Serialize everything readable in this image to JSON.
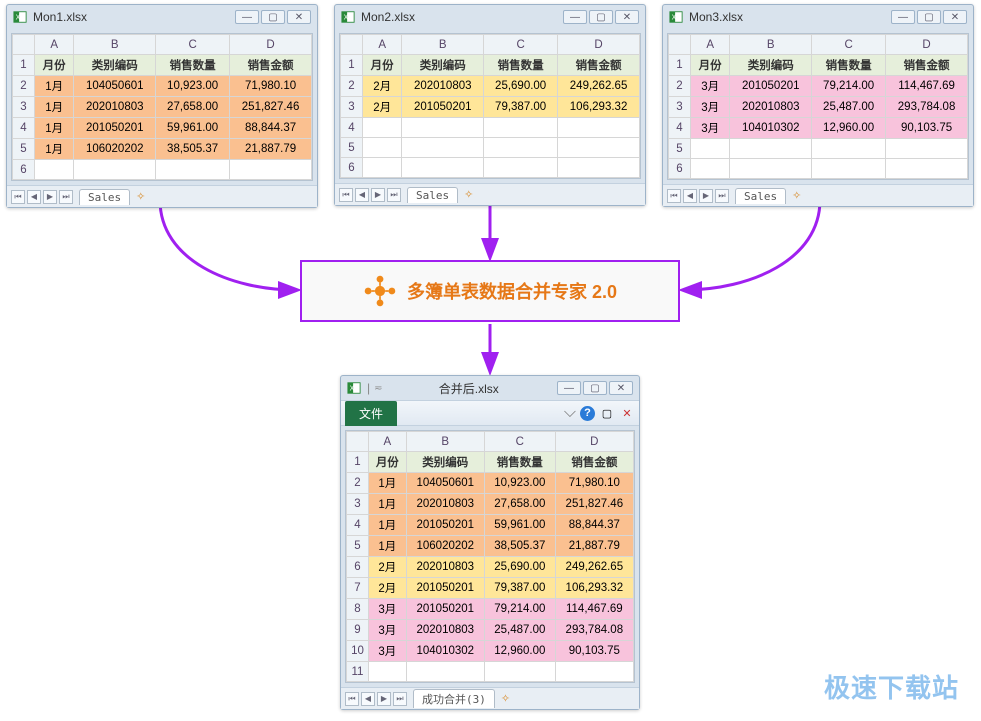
{
  "watermark": "极速下载站",
  "hub": {
    "label": "多簿单表数据合并专家 2.0"
  },
  "columns": [
    "A",
    "B",
    "C",
    "D"
  ],
  "headers": [
    "月份",
    "类别编码",
    "销售数量",
    "销售金额"
  ],
  "windows": {
    "w1": {
      "title": "Mon1.xlsx",
      "sheet": "Sales",
      "colorClass": "row-orange",
      "rows": [
        [
          "1月",
          "104050601",
          "10,923.00",
          "71,980.10"
        ],
        [
          "1月",
          "202010803",
          "27,658.00",
          "251,827.46"
        ],
        [
          "1月",
          "201050201",
          "59,961.00",
          "88,844.37"
        ],
        [
          "1月",
          "106020202",
          "38,505.37",
          "21,887.79"
        ]
      ]
    },
    "w2": {
      "title": "Mon2.xlsx",
      "sheet": "Sales",
      "colorClass": "row-yellow",
      "rows": [
        [
          "2月",
          "202010803",
          "25,690.00",
          "249,262.65"
        ],
        [
          "2月",
          "201050201",
          "79,387.00",
          "106,293.32"
        ]
      ]
    },
    "w3": {
      "title": "Mon3.xlsx",
      "sheet": "Sales",
      "colorClass": "row-pink",
      "rows": [
        [
          "3月",
          "201050201",
          "79,214.00",
          "114,467.69"
        ],
        [
          "3月",
          "202010803",
          "25,487.00",
          "293,784.08"
        ],
        [
          "3月",
          "104010302",
          "12,960.00",
          "90,103.75"
        ]
      ]
    },
    "w4": {
      "title": "合并后.xlsx",
      "sheet": "成功合并(3)",
      "fileLabel": "文件",
      "rows": [
        {
          "c": "row-orange",
          "v": [
            "1月",
            "104050601",
            "10,923.00",
            "71,980.10"
          ]
        },
        {
          "c": "row-orange",
          "v": [
            "1月",
            "202010803",
            "27,658.00",
            "251,827.46"
          ]
        },
        {
          "c": "row-orange",
          "v": [
            "1月",
            "201050201",
            "59,961.00",
            "88,844.37"
          ]
        },
        {
          "c": "row-orange",
          "v": [
            "1月",
            "106020202",
            "38,505.37",
            "21,887.79"
          ]
        },
        {
          "c": "row-yellow",
          "v": [
            "2月",
            "202010803",
            "25,690.00",
            "249,262.65"
          ]
        },
        {
          "c": "row-yellow",
          "v": [
            "2月",
            "201050201",
            "79,387.00",
            "106,293.32"
          ]
        },
        {
          "c": "row-pink",
          "v": [
            "3月",
            "201050201",
            "79,214.00",
            "114,467.69"
          ]
        },
        {
          "c": "row-pink",
          "v": [
            "3月",
            "202010803",
            "25,487.00",
            "293,784.08"
          ]
        },
        {
          "c": "row-pink",
          "v": [
            "3月",
            "104010302",
            "12,960.00",
            "90,103.75"
          ]
        }
      ]
    }
  },
  "chart_data": {
    "type": "table",
    "title": "多簿单表数据合并专家 2.0 — merge three workbooks into one",
    "inputs": [
      {
        "file": "Mon1.xlsx",
        "sheet": "Sales",
        "month": "1月",
        "rows": [
          {
            "类别编码": "104050601",
            "销售数量": 10923.0,
            "销售金额": 71980.1
          },
          {
            "类别编码": "202010803",
            "销售数量": 27658.0,
            "销售金额": 251827.46
          },
          {
            "类别编码": "201050201",
            "销售数量": 59961.0,
            "销售金额": 88844.37
          },
          {
            "类别编码": "106020202",
            "销售数量": 38505.37,
            "销售金额": 21887.79
          }
        ]
      },
      {
        "file": "Mon2.xlsx",
        "sheet": "Sales",
        "month": "2月",
        "rows": [
          {
            "类别编码": "202010803",
            "销售数量": 25690.0,
            "销售金额": 249262.65
          },
          {
            "类别编码": "201050201",
            "销售数量": 79387.0,
            "销售金额": 106293.32
          }
        ]
      },
      {
        "file": "Mon3.xlsx",
        "sheet": "Sales",
        "month": "3月",
        "rows": [
          {
            "类别编码": "201050201",
            "销售数量": 79214.0,
            "销售金额": 114467.69
          },
          {
            "类别编码": "202010803",
            "销售数量": 25487.0,
            "销售金额": 293784.08
          },
          {
            "类别编码": "104010302",
            "销售数量": 12960.0,
            "销售金额": 90103.75
          }
        ]
      }
    ],
    "output": {
      "file": "合并后.xlsx",
      "sheet": "成功合并(3)",
      "columns": [
        "月份",
        "类别编码",
        "销售数量",
        "销售金额"
      ]
    }
  }
}
